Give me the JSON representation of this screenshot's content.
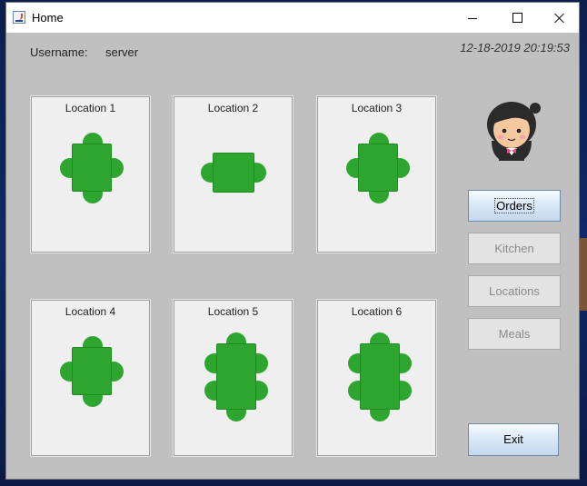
{
  "window": {
    "title": "Home"
  },
  "header": {
    "username_label": "Username:",
    "username_value": "server",
    "datetime": "12-18-2019 20:19:53"
  },
  "locations": [
    {
      "label": "Location 1"
    },
    {
      "label": "Location 2"
    },
    {
      "label": "Location 3"
    },
    {
      "label": "Location 4"
    },
    {
      "label": "Location 5"
    },
    {
      "label": "Location 6"
    }
  ],
  "sidebar": {
    "orders": "Orders",
    "kitchen": "Kitchen",
    "locations": "Locations",
    "meals": "Meals"
  },
  "exit_label": "Exit",
  "colors": {
    "table_green": "#2ea52e",
    "panel_bg": "#c0c0c0",
    "card_bg": "#efefef"
  }
}
